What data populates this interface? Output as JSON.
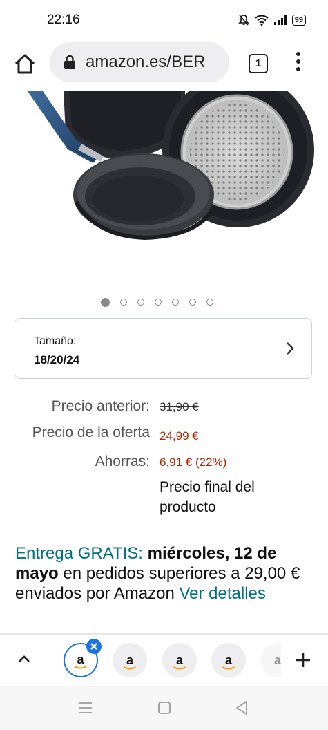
{
  "status_bar": {
    "time": "22:16",
    "battery": "99",
    "icons": [
      "mute-icon",
      "wifi-icon",
      "signal-icon",
      "battery-icon"
    ]
  },
  "browser": {
    "url": "amazon.es/BER",
    "tab_count": "1"
  },
  "carousel": {
    "total": 7,
    "active": 0
  },
  "size_selector": {
    "label": "Tamaño:",
    "value": "18/20/24"
  },
  "pricing": {
    "previous_label": "Precio anterior:",
    "previous_value": "31,90 €",
    "deal_label": "Precio de la oferta",
    "deal_value": "24,99 €",
    "savings_label": "Ahorras:",
    "savings_value": "6,91 € (22%)",
    "final_note": "Precio final del producto"
  },
  "delivery": {
    "prefix": "Entrega GRATIS:",
    "date": "miércoles, 12 de mayo",
    "middle": "en pedidos superiores a 29,00 € enviados por Amazon",
    "link": "Ver detalles"
  },
  "tab_strip": {
    "tabs": [
      "a",
      "a",
      "a",
      "a",
      "a"
    ]
  },
  "colors": {
    "price_red": "#b12704",
    "link_teal": "#007185",
    "accent_blue": "#1a73e8"
  }
}
